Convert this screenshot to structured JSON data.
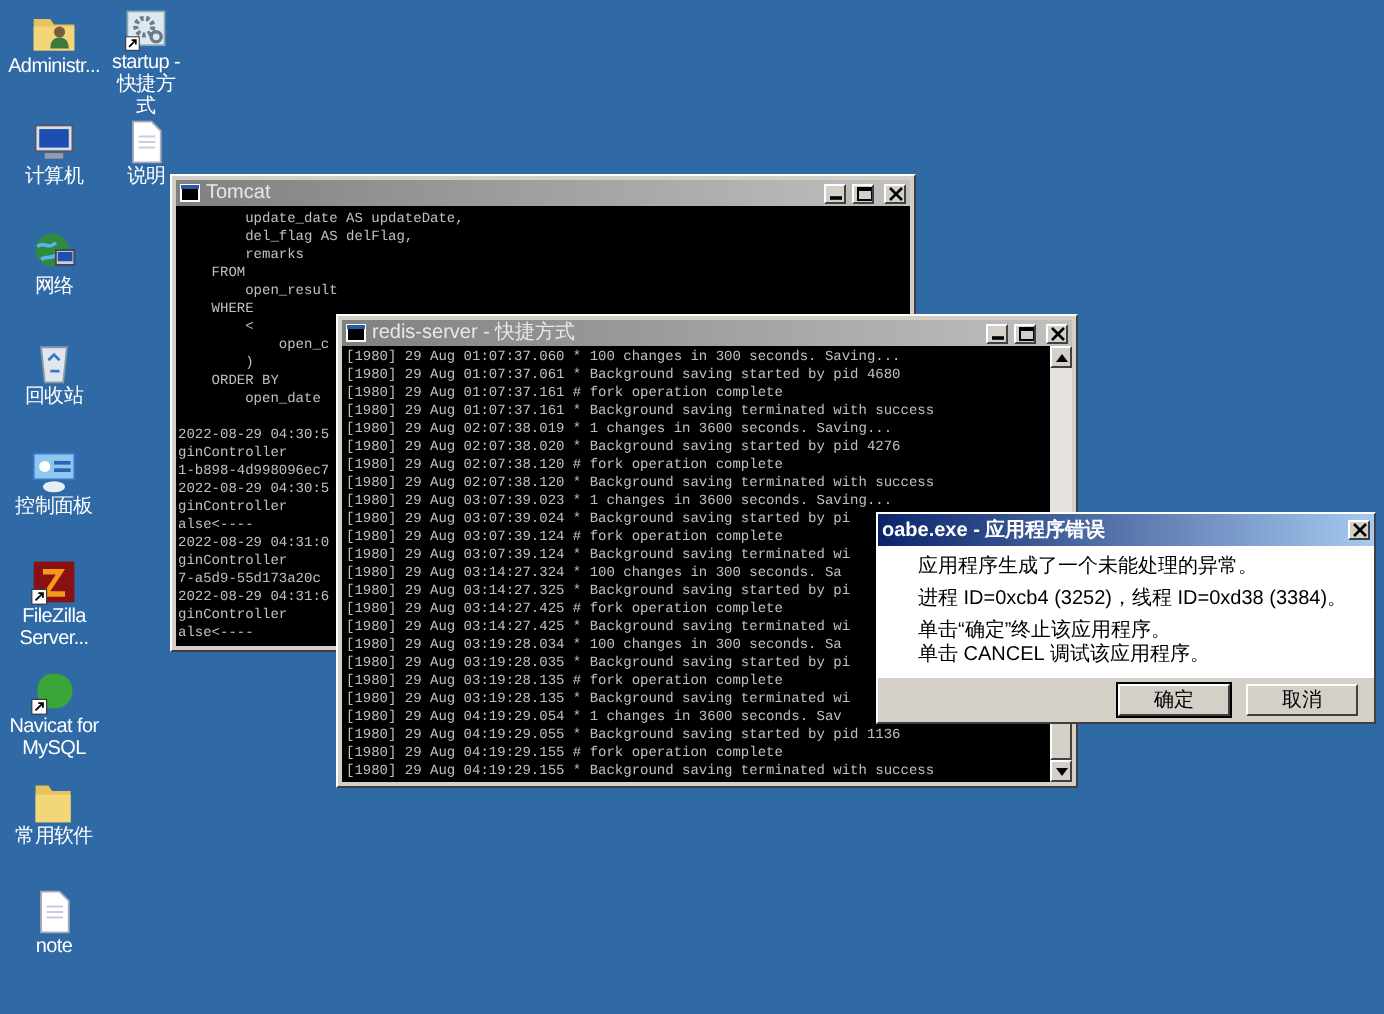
{
  "desktop_columns": [
    [
      {
        "label": "Administr...",
        "kind": "user-folder",
        "shortcut": false
      },
      {
        "label": "计算机",
        "kind": "computer",
        "shortcut": false
      },
      {
        "label": "网络",
        "kind": "network",
        "shortcut": false
      },
      {
        "label": "回收站",
        "kind": "recycle-bin",
        "shortcut": false
      },
      {
        "label": "控制面板",
        "kind": "control-panel",
        "shortcut": false
      },
      {
        "label": "FileZilla Server...",
        "kind": "filezilla",
        "shortcut": true
      },
      {
        "label": "Navicat for MySQL",
        "kind": "navicat",
        "shortcut": true
      },
      {
        "label": "常用软件",
        "kind": "folder",
        "shortcut": false
      },
      {
        "label": "note",
        "kind": "document",
        "shortcut": false
      }
    ],
    [
      {
        "label": "startup - 快捷方式",
        "kind": "settings",
        "shortcut": true
      },
      {
        "label": "说明",
        "kind": "document",
        "shortcut": false
      }
    ]
  ],
  "tomcat_window": {
    "title": "Tomcat",
    "sql_lines": [
      "        update_date AS updateDate,",
      "        del_flag AS delFlag,",
      "        remarks",
      "    FROM",
      "        open_result",
      "    WHERE",
      "        <",
      "            open_c",
      "        )",
      "    ORDER BY",
      "        open_date"
    ],
    "log_lines": [
      "2022-08-29 04:30:5",
      "ginController",
      "1-b898-4d998096ec7",
      "2022-08-29 04:30:5",
      "ginController",
      "alse<----",
      "2022-08-29 04:31:0",
      "ginController",
      "7-a5d9-55d173a20c",
      "2022-08-29 04:31:6",
      "ginController",
      "alse<----"
    ]
  },
  "redis_window": {
    "title": "redis-server - 快捷方式",
    "lines": [
      "[1980] 29 Aug 01:07:37.060 * 100 changes in 300 seconds. Saving...",
      "[1980] 29 Aug 01:07:37.061 * Background saving started by pid 4680",
      "[1980] 29 Aug 01:07:37.161 # fork operation complete",
      "[1980] 29 Aug 01:07:37.161 * Background saving terminated with success",
      "[1980] 29 Aug 02:07:38.019 * 1 changes in 3600 seconds. Saving...",
      "[1980] 29 Aug 02:07:38.020 * Background saving started by pid 4276",
      "[1980] 29 Aug 02:07:38.120 # fork operation complete",
      "[1980] 29 Aug 02:07:38.120 * Background saving terminated with success",
      "[1980] 29 Aug 03:07:39.023 * 1 changes in 3600 seconds. Saving...",
      "[1980] 29 Aug 03:07:39.024 * Background saving started by pi",
      "[1980] 29 Aug 03:07:39.124 # fork operation complete",
      "[1980] 29 Aug 03:07:39.124 * Background saving terminated wi",
      "[1980] 29 Aug 03:14:27.324 * 100 changes in 300 seconds. Sa",
      "[1980] 29 Aug 03:14:27.325 * Background saving started by pi",
      "[1980] 29 Aug 03:14:27.425 # fork operation complete",
      "[1980] 29 Aug 03:14:27.425 * Background saving terminated wi",
      "[1980] 29 Aug 03:19:28.034 * 100 changes in 300 seconds. Sa",
      "[1980] 29 Aug 03:19:28.035 * Background saving started by pi",
      "[1980] 29 Aug 03:19:28.135 # fork operation complete",
      "[1980] 29 Aug 03:19:28.135 * Background saving terminated wi",
      "[1980] 29 Aug 04:19:29.054 * 1 changes in 3600 seconds. Sav",
      "[1980] 29 Aug 04:19:29.055 * Background saving started by pid 1136",
      "[1980] 29 Aug 04:19:29.155 # fork operation complete",
      "[1980] 29 Aug 04:19:29.155 * Background saving terminated with success"
    ]
  },
  "error_dialog": {
    "title": "oabe.exe - 应用程序错误",
    "message": "应用程序生成了一个未能处理的异常。",
    "process_info": "进程 ID=0xcb4 (3252)，线程 ID=0xd38 (3384)。",
    "hints": [
      "单击“确定”终止该应用程序。",
      "单击 CANCEL 调试该应用程序。"
    ],
    "buttons": [
      {
        "label": "确定",
        "selected": true
      },
      {
        "label": "取消",
        "selected": false
      }
    ]
  }
}
